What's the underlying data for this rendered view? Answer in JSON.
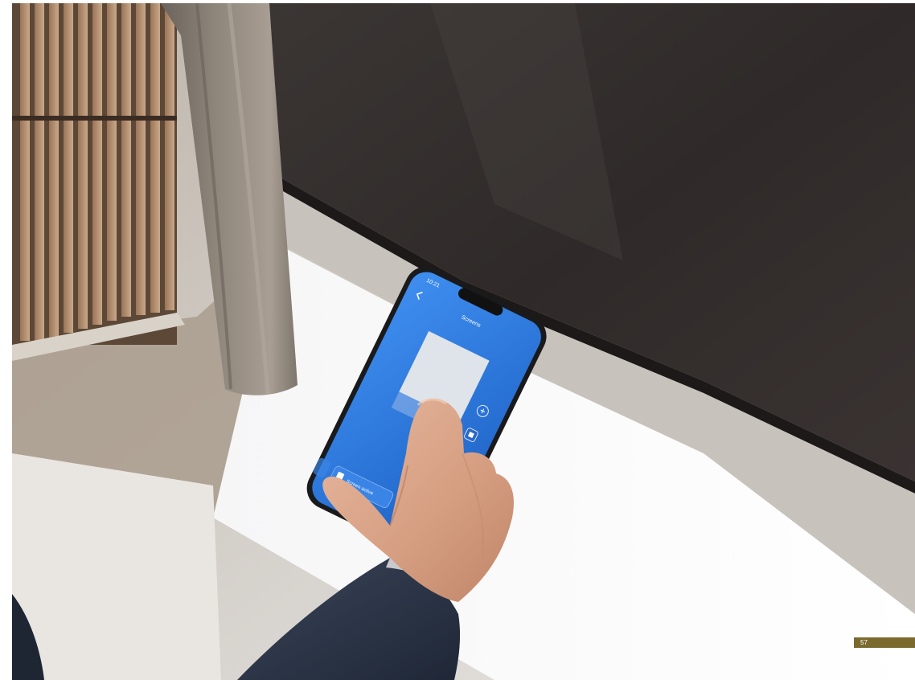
{
  "phone": {
    "status_time": "10:21",
    "screen_title": "Screens",
    "bottom_button_label": "Screen active",
    "back_icon": "chevron-left-icon",
    "add_icon": "plus-circle-icon",
    "stop_icon": "stop-square-icon",
    "accent_color": "#2f7fe0"
  },
  "page": {
    "number": "57",
    "tab_color": "#7a6a2e"
  }
}
